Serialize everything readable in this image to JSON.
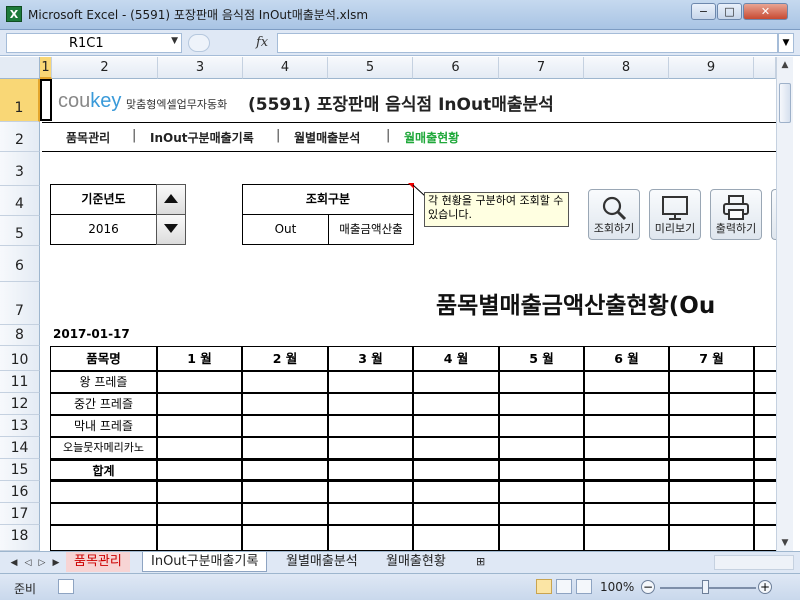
{
  "window": {
    "title": "Microsoft Excel - (5591) 포장판매 음식점 InOut매출분석.xlsm",
    "minimize": "−",
    "maximize": "□",
    "close": "✕"
  },
  "formula_bar": {
    "name_box": "R1C1",
    "fx_label": "fx",
    "formula": ""
  },
  "column_headers": [
    "1",
    "2",
    "3",
    "4",
    "5",
    "6",
    "7",
    "8",
    "9"
  ],
  "row_headers": [
    "1",
    "2",
    "3",
    "4",
    "5",
    "6",
    "7",
    "8",
    "10",
    "11",
    "12",
    "13",
    "14",
    "15",
    "16",
    "17",
    "18"
  ],
  "header": {
    "logo_cou": "cou",
    "logo_key": "key",
    "logo_sub": "맞춤형엑셀업무자동화",
    "title": "(5591) 포장판매 음식점 InOut매출분석"
  },
  "nav": [
    "품목관리",
    "InOut구분매출기록",
    "월별매출분석",
    "월매출현황"
  ],
  "nav_sep": "|",
  "controls": {
    "year_label": "기준년도",
    "year_value": "2016",
    "query_label": "조회구분",
    "query_value_1": "Out",
    "query_value_2": "매출금액산출",
    "comment": "각 현황을 구분하여 조회할 수있습니다."
  },
  "toolbar": {
    "search_label": "조회하기",
    "preview_label": "미리보기",
    "print_label": "출력하기"
  },
  "report": {
    "title": "품목별매출금액산출현황(Ou",
    "date": "2017-01-17",
    "columns": [
      "품목명",
      "1 월",
      "2 월",
      "3 월",
      "4 월",
      "5 월",
      "6 월",
      "7 월"
    ],
    "items": [
      "왕 프레즐",
      "중간 프레즐",
      "막내 프레즐",
      "오늘뭇자메리카노"
    ],
    "total_label": "합계"
  },
  "sheet_tabs": [
    "품목관리",
    "InOut구분매출기록",
    "월별매출분석",
    "월매출현황"
  ],
  "status": {
    "ready": "준비",
    "zoom": "100%",
    "zoom_minus": "−",
    "zoom_plus": "+"
  }
}
